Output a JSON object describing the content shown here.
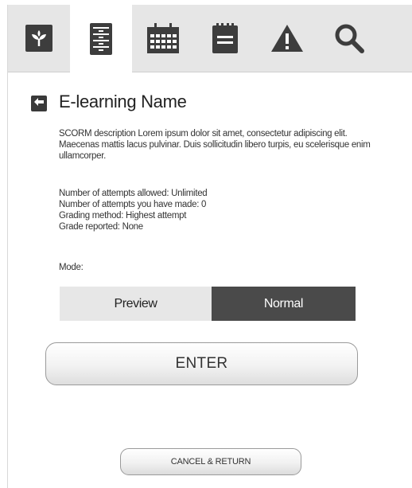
{
  "nav": {
    "tabs": [
      {
        "icon": "plant-logo-icon",
        "active": false
      },
      {
        "icon": "file-cabinet-icon",
        "active": true
      },
      {
        "icon": "calendar-icon",
        "active": false
      },
      {
        "icon": "notepad-icon",
        "active": false
      },
      {
        "icon": "warning-icon",
        "active": false
      },
      {
        "icon": "search-icon",
        "active": false
      }
    ]
  },
  "page": {
    "title": "E-learning Name",
    "description": "SCORM description Lorem ipsum dolor sit amet, consectetur adipiscing elit. Maecenas mattis lacus pulvinar. Duis sollicitudin libero turpis, eu scelerisque enim ullamcorper.",
    "info": [
      "Number of attempts allowed: Unlimited",
      "Number of attempts you have made: 0",
      "Grading method: Highest attempt",
      "Grade reported: None"
    ],
    "mode_label": "Mode:"
  },
  "mode": {
    "options": [
      "Preview",
      "Normal"
    ],
    "selected": "Normal"
  },
  "actions": {
    "enter_label": "ENTER",
    "cancel_label": "CANCEL & RETURN"
  },
  "colors": {
    "topbar": "#e6e6e6",
    "icon": "#3d3d3d",
    "selected_segment": "#4a4a4a",
    "unselected_segment": "#e7e7e7"
  }
}
